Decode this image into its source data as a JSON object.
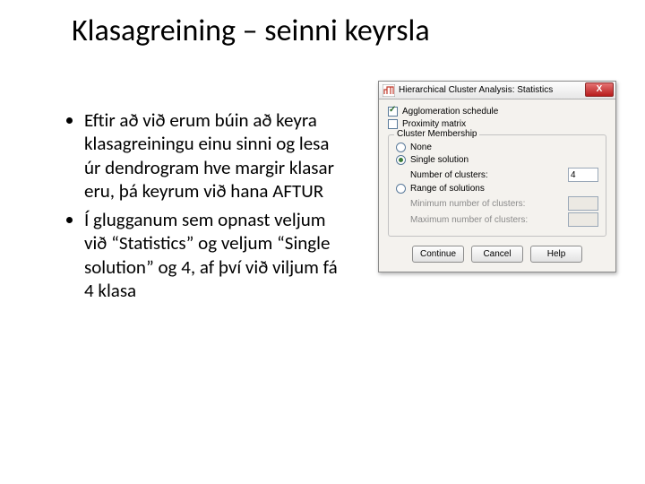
{
  "title": "Klasagreining – seinni keyrsla",
  "bullets": [
    "Eftir að við erum búin að keyra klasagreiningu einu sinni og lesa úr dendrogram hve margir klasar eru, þá keyrum við hana AFTUR",
    "Í glugganum sem opnast veljum við “Statistics” og veljum “Single solution” og 4, af því við viljum fá 4 klasa"
  ],
  "dialog": {
    "title": "Hierarchical Cluster Analysis: Statistics",
    "close_glyph": "X",
    "checkboxes": {
      "agglom": {
        "label": "Agglomeration schedule",
        "checked": true
      },
      "prox": {
        "label": "Proximity matrix",
        "checked": false
      }
    },
    "group_title": "Cluster Membership",
    "radios": {
      "none": {
        "label": "None"
      },
      "single": {
        "label": "Single solution"
      },
      "range": {
        "label": "Range of solutions"
      },
      "selected": "single"
    },
    "fields": {
      "num_clusters": {
        "label": "Number of clusters:",
        "value": "4"
      },
      "min_clusters": {
        "label": "Minimum number of clusters:",
        "value": ""
      },
      "max_clusters": {
        "label": "Maximum number of clusters:",
        "value": ""
      }
    },
    "buttons": {
      "continue": "Continue",
      "cancel": "Cancel",
      "help": "Help"
    }
  }
}
